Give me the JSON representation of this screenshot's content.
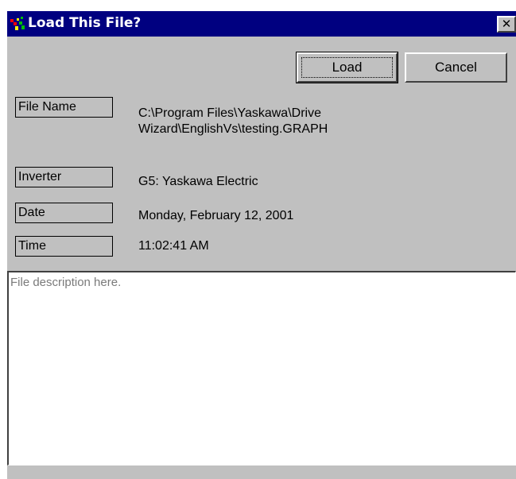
{
  "window": {
    "title": "Load This File?",
    "close_glyph": "✕",
    "icon": "graph-app-icon"
  },
  "buttons": {
    "load_label": "Load",
    "cancel_label": "Cancel"
  },
  "fields": [
    {
      "label": "File Name",
      "value_lines": [
        "C:\\Program Files\\Yaskawa\\Drive",
        "Wizard\\EnglishVs\\testing.GRAPH"
      ]
    },
    {
      "label": "Inverter",
      "value": "G5: Yaskawa Electric"
    },
    {
      "label": "Date",
      "value": "Monday, February 12, 2001"
    },
    {
      "label": "Time",
      "value": "11:02:41 AM"
    }
  ],
  "description": {
    "text": "File description here."
  },
  "colors": {
    "titlebar": "#000080",
    "face": "#c0c0c0",
    "description_text": "#7a7a7a"
  }
}
